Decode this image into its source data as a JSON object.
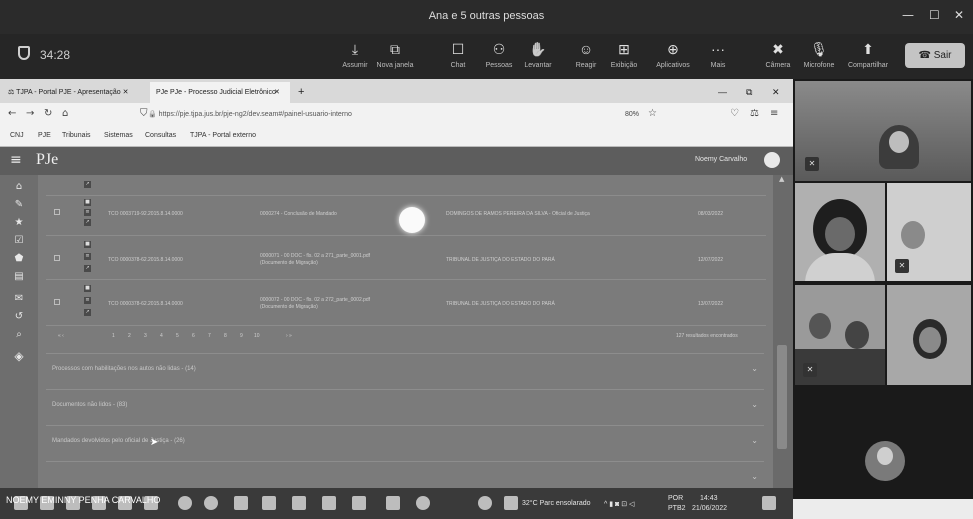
{
  "window": {
    "title": "Ana e 5 outras pessoas",
    "minimize": "—",
    "maximize": "☐",
    "close": "✕"
  },
  "toolbar": {
    "timer": "34:28",
    "buttons": [
      {
        "label": "Assumir",
        "icon": "⤓"
      },
      {
        "label": "Nova janela",
        "icon": "⧉"
      },
      {
        "label": "Chat",
        "icon": "☐"
      },
      {
        "label": "Pessoas",
        "icon": "⚇"
      },
      {
        "label": "Levantar",
        "icon": "✋"
      },
      {
        "label": "Reagir",
        "icon": "☺"
      },
      {
        "label": "Exibição",
        "icon": "⊞"
      },
      {
        "label": "Aplicativos",
        "icon": "⊕"
      },
      {
        "label": "Mais",
        "icon": "···"
      },
      {
        "label": "Câmera",
        "icon": "✖"
      },
      {
        "label": "Microfone",
        "icon": "🎙"
      },
      {
        "label": "Compartilhar",
        "icon": "⬆"
      }
    ],
    "leave": "Sair"
  },
  "browser": {
    "tabs": [
      {
        "label": "TJPA - Portal PJE - Apresentação ✕"
      },
      {
        "label": "PJe - Processo Judicial Eletrônico"
      }
    ],
    "tab_close": "✕",
    "new_tab": "+",
    "url": "https://pje.tjpa.jus.br/pje-ng2/dev.seam#/painel-usuario-interno",
    "zoom": "80%",
    "bookmarks": [
      "CNJ",
      "PJE",
      "Tribunais",
      "Sistemas",
      "Consultas",
      "TJPA - Portal externo"
    ]
  },
  "pje": {
    "logo": "PJe",
    "user": "Noemy Carvalho"
  },
  "table": {
    "rows": [
      {
        "process": "TCO 0003719-92.2015.8.14.0000",
        "doc": "0000274 - Conclusão de Mandado",
        "party": "DOMINGOS DE RAMOS PEREIRA DA SILVA - Oficial de Justiça",
        "date": "08/03/2022"
      },
      {
        "process": "TCO 0000378-62.2015.8.14.0000",
        "doc": "0000071 - 00 DOC - fls. 02 a 271_parte_0001.pdf",
        "sub": "(Documento de Migração)",
        "party": "TRIBUNAL DE JUSTIÇA DO ESTADO DO PARÁ",
        "date": "12/07/2022"
      },
      {
        "process": "TCO 0000378-62.2015.8.14.0000",
        "doc": "0000072 - 00 DOC - fls. 02 a 272_parte_0002.pdf",
        "sub": "(Documento de Migração)",
        "party": "TRIBUNAL DE JUSTIÇA DO ESTADO DO PARÁ",
        "date": "13/07/2022"
      }
    ],
    "pagination": [
      "1",
      "2",
      "3",
      "4",
      "5",
      "6",
      "7",
      "8",
      "9",
      "10"
    ],
    "pagination_prev": "« ‹",
    "pagination_next": "› »",
    "total": "127 resultados encontrados"
  },
  "sections": [
    {
      "title": "Processos com habilitações nos autos não lidas - (14)"
    },
    {
      "title": "Documentos não lidos - (83)"
    },
    {
      "title": "Mandados devolvidos pelo oficial de Justiça - (26)"
    }
  ],
  "taskbar": {
    "presenter": "NOEMY EMINNY PENHA CARVALHO",
    "weather": "32°C Parc ensolarado",
    "lang1": "POR",
    "lang2": "PTB2",
    "time": "14:43",
    "date": "21/06/2022"
  }
}
